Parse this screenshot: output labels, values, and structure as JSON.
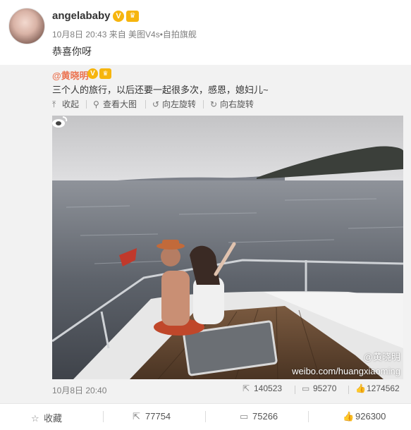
{
  "post": {
    "username": "angelababy",
    "verified_icon": "v-badge-icon",
    "member_icon": "crown-badge-icon",
    "meta": "10月8日 20:43 来自 美图V4s•自拍旗舰",
    "text": "恭喜你呀"
  },
  "repost": {
    "author": "@黄晓明",
    "text": "三个人的旅行，以后还要一起很多次，感恩，媳妇儿~",
    "tools": [
      {
        "label": "收起",
        "icon": "collapse-icon"
      },
      {
        "label": "查看大图",
        "icon": "zoom-icon"
      },
      {
        "label": "向左旋转",
        "icon": "rotate-left-icon"
      },
      {
        "label": "向右旋转",
        "icon": "rotate-right-icon"
      }
    ],
    "watermark_handle": "@黄晓明",
    "watermark_url": "weibo.com/huangxiaoming",
    "time": "10月8日 20:40",
    "stats": {
      "forward": "140523",
      "comment": "95270",
      "like": "1274562"
    }
  },
  "footer": {
    "favorite": "收藏",
    "forward": "77754",
    "comment": "75266",
    "like": "926300"
  },
  "colors": {
    "accent_link": "#eb7350",
    "badge_gold": "#f6b50e",
    "repost_bg": "#f2f2f2"
  }
}
